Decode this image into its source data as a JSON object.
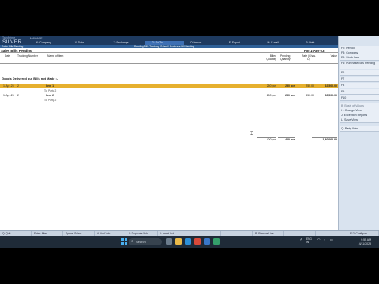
{
  "app": {
    "logo_top": "TallyPrime",
    "logo": "SILVER",
    "company_label": "MANAGE",
    "menu": [
      {
        "label": "K: Company",
        "active": false
      },
      {
        "label": "Y: Data",
        "active": false
      },
      {
        "label": "Z: Exchange",
        "active": false
      },
      {
        "label": "G: Go To",
        "active": true
      },
      {
        "label": "O: Import",
        "active": false
      },
      {
        "label": "E: Export",
        "active": false
      },
      {
        "label": "M: E-mail",
        "active": false
      },
      {
        "label": "P: Print",
        "active": false
      }
    ],
    "help": "F1: Help"
  },
  "titlebar": {
    "left": "Sales Bills Pending",
    "center": "Pending Bills Tracking: Sales & Purchase Bill Pending"
  },
  "report": {
    "title": "Sales Bills Pending",
    "period": "For 1-Apr-23",
    "columns": {
      "date": "Date",
      "tracking": "Tracking Number",
      "item": "Name of Item",
      "billed": "Billed Quantity",
      "pending": "Pending Quantity",
      "rate": "Rate (Chas. D)",
      "value": "Value"
    },
    "group": "Goods Delivered but Bills not Made :-",
    "rows": [
      {
        "date": "1-Apr-23",
        "tracking": "2",
        "item": "Item 1",
        "party": "To: Party 2",
        "billed": "250 pcs",
        "pending": "250 pcs",
        "rate": "250.00",
        "value": "62,500.00",
        "selected": true
      },
      {
        "date": "1-Apr-23",
        "tracking": "2",
        "item": "Item 2",
        "party": "To: Party 2",
        "billed": "250 pcs",
        "pending": "250 pcs",
        "rate": "350.00",
        "value": "52,500.00",
        "selected": false
      }
    ],
    "totals": {
      "billed": "400 pcs",
      "pending": "400 pcs",
      "value": "1,40,000.00"
    }
  },
  "right_panel": [
    {
      "label": "F2: Period"
    },
    {
      "label": "F3: Company"
    },
    {
      "label": "F4: Stock Item"
    },
    {
      "label": "F5: Purchase Bills Pending"
    },
    {
      "label": "F6"
    },
    {
      "label": "F7"
    },
    {
      "label": "F8"
    },
    {
      "label": "F9"
    },
    {
      "label": "F10"
    },
    {
      "label": "B: Basis of Values"
    },
    {
      "label": "H: Change View"
    },
    {
      "label": "J: Exception Reports"
    },
    {
      "label": "L: Save View"
    },
    {
      "label": "Q: Party Wise"
    }
  ],
  "fkeys": [
    {
      "label": "Q: Quit"
    },
    {
      "label": "Enter: Alter"
    },
    {
      "label": "Space: Select"
    },
    {
      "label": "A: Add Vch"
    },
    {
      "label": "2: Duplicate Vch"
    },
    {
      "label": "I: Insert Vch"
    },
    {
      "label": ""
    },
    {
      "label": ""
    },
    {
      "label": "R: Remove Line"
    },
    {
      "label": ""
    },
    {
      "label": ""
    },
    {
      "label": "F12: Configure"
    }
  ],
  "taskbar": {
    "search_placeholder": "Search",
    "lang": "ENG IN",
    "time": "9:55 AM",
    "date": "4/11/2023"
  }
}
